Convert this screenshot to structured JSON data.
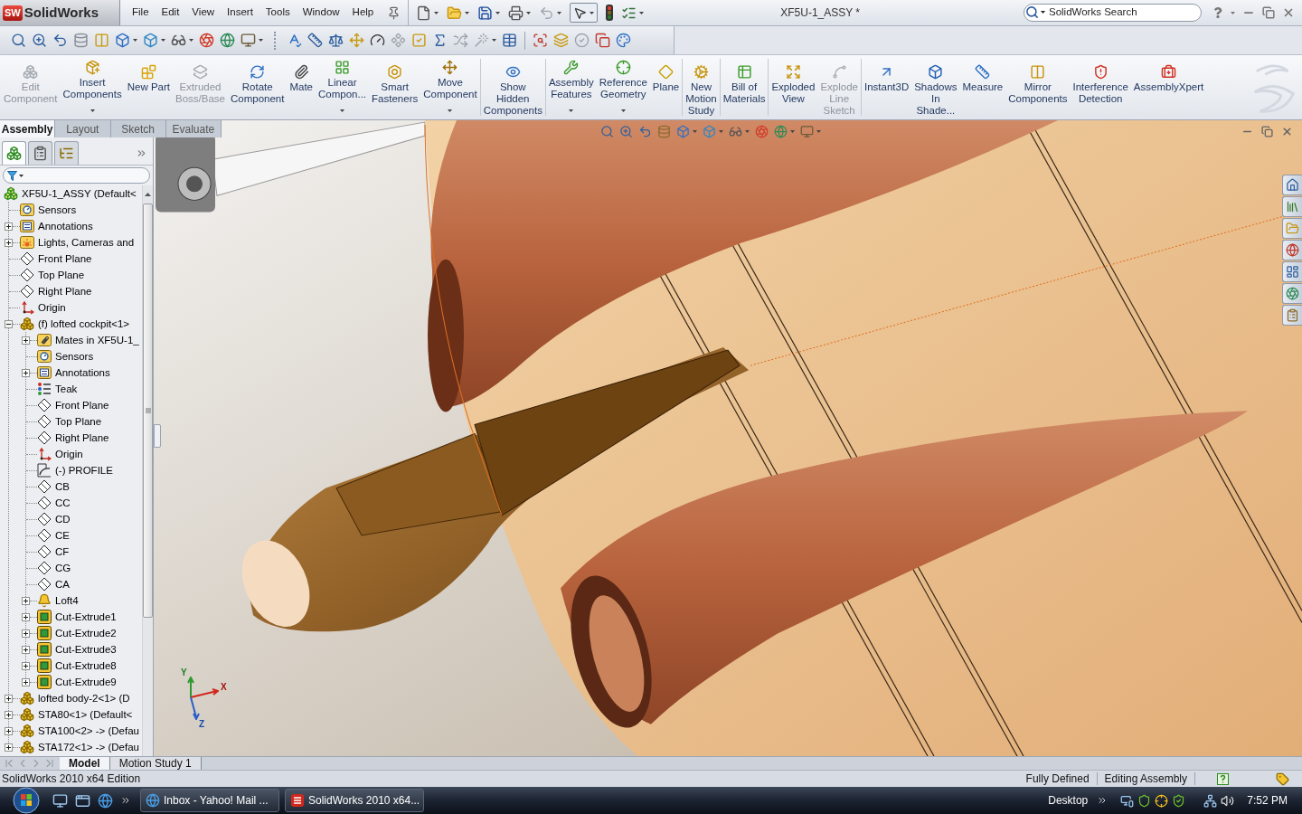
{
  "title_bar": {
    "logo_badge": "SW",
    "logo": "SolidWorks",
    "menus": [
      "File",
      "Edit",
      "View",
      "Insert",
      "Tools",
      "Window",
      "Help"
    ],
    "document_title": "XF5U-1_ASSY *",
    "search": {
      "placeholder": "SolidWorks Search"
    }
  },
  "command_groups": [
    [
      {
        "label": "Edit\nComponent",
        "disabled": true,
        "dropdown": false
      },
      {
        "label": "Insert\nComponents",
        "disabled": false,
        "dropdown": true
      },
      {
        "label": "New Part",
        "disabled": false,
        "dropdown": false
      },
      {
        "label": "Extruded\nBoss/Base",
        "disabled": true,
        "dropdown": false
      },
      {
        "label": "Rotate\nComponent",
        "disabled": false,
        "dropdown": false
      },
      {
        "label": "Mate",
        "disabled": false,
        "dropdown": false
      },
      {
        "label": "Linear\nCompon...",
        "disabled": false,
        "dropdown": true
      },
      {
        "label": "Smart\nFasteners",
        "disabled": false,
        "dropdown": false
      },
      {
        "label": "Move\nComponent",
        "disabled": false,
        "dropdown": true
      }
    ],
    [
      {
        "label": "Show\nHidden\nComponents",
        "disabled": false,
        "dropdown": false
      }
    ],
    [
      {
        "label": "Assembly\nFeatures",
        "disabled": false,
        "dropdown": true
      },
      {
        "label": "Reference\nGeometry",
        "disabled": false,
        "dropdown": true
      },
      {
        "label": "Plane",
        "disabled": false,
        "dropdown": false
      }
    ],
    [
      {
        "label": "New\nMotion\nStudy",
        "disabled": false,
        "dropdown": false
      }
    ],
    [
      {
        "label": "Bill of\nMaterials",
        "disabled": false,
        "dropdown": false
      }
    ],
    [
      {
        "label": "Exploded\nView",
        "disabled": false,
        "dropdown": false
      },
      {
        "label": "Explode\nLine\nSketch",
        "disabled": true,
        "dropdown": false
      }
    ],
    [
      {
        "label": "Instant3D",
        "disabled": false,
        "dropdown": false
      },
      {
        "label": "Shadows\nIn\nShade...",
        "disabled": false,
        "dropdown": false
      },
      {
        "label": "Measure",
        "disabled": false,
        "dropdown": false
      },
      {
        "label": "Mirror\nComponents",
        "disabled": false,
        "dropdown": false
      },
      {
        "label": "Interference\nDetection",
        "disabled": false,
        "dropdown": false
      },
      {
        "label": "AssemblyXpert",
        "disabled": false,
        "dropdown": false
      }
    ]
  ],
  "command_tabs": [
    {
      "label": "Assembly",
      "selected": true
    },
    {
      "label": "Layout",
      "selected": false
    },
    {
      "label": "Sketch",
      "selected": false
    },
    {
      "label": "Evaluate",
      "selected": false
    }
  ],
  "feature_tree": {
    "panel_tabs": [
      {
        "selected": true
      },
      {
        "selected": false
      },
      {
        "selected": false
      }
    ],
    "items": [
      {
        "label": "XF5U-1_ASSY (Default<",
        "kind": "assembly",
        "children": [
          {
            "label": "Sensors",
            "kind": "sensors"
          },
          {
            "label": "Annotations",
            "kind": "annotations",
            "expanded": false
          },
          {
            "label": "Lights, Cameras and",
            "kind": "lights",
            "expanded": false
          },
          {
            "label": "Front Plane",
            "kind": "plane"
          },
          {
            "label": "Top Plane",
            "kind": "plane"
          },
          {
            "label": "Right Plane",
            "kind": "plane"
          },
          {
            "label": "Origin",
            "kind": "origin"
          },
          {
            "label": "(f) lofted cockpit<1>",
            "kind": "part",
            "expanded": true,
            "children": [
              {
                "label": "Mates in XF5U-1_",
                "kind": "mates",
                "expanded": false
              },
              {
                "label": "Sensors",
                "kind": "sensors"
              },
              {
                "label": "Annotations",
                "kind": "annotations",
                "expanded": false
              },
              {
                "label": "Teak",
                "kind": "material"
              },
              {
                "label": "Front Plane",
                "kind": "plane"
              },
              {
                "label": "Top Plane",
                "kind": "plane"
              },
              {
                "label": "Right Plane",
                "kind": "plane"
              },
              {
                "label": "Origin",
                "kind": "origin"
              },
              {
                "label": "(-) PROFILE",
                "kind": "sketch"
              },
              {
                "label": "CB",
                "kind": "plane"
              },
              {
                "label": "CC",
                "kind": "plane"
              },
              {
                "label": "CD",
                "kind": "plane"
              },
              {
                "label": "CE",
                "kind": "plane"
              },
              {
                "label": "CF",
                "kind": "plane"
              },
              {
                "label": "CG",
                "kind": "plane"
              },
              {
                "label": "CA",
                "kind": "plane"
              },
              {
                "label": "Loft4",
                "kind": "loft",
                "expanded": false
              },
              {
                "label": "Cut-Extrude1",
                "kind": "cut",
                "expanded": false
              },
              {
                "label": "Cut-Extrude2",
                "kind": "cut",
                "expanded": false
              },
              {
                "label": "Cut-Extrude3",
                "kind": "cut",
                "expanded": false
              },
              {
                "label": "Cut-Extrude8",
                "kind": "cut",
                "expanded": false
              },
              {
                "label": "Cut-Extrude9",
                "kind": "cut",
                "expanded": false
              }
            ]
          },
          {
            "label": "lofted body-2<1> (D",
            "kind": "part",
            "expanded": false
          },
          {
            "label": "STA80<1> (Default<",
            "kind": "part",
            "expanded": false
          },
          {
            "label": "STA100<2> -> (Defau",
            "kind": "part",
            "expanded": false
          },
          {
            "label": "STA172<1> -> (Defau",
            "kind": "part",
            "expanded": false
          }
        ]
      }
    ]
  },
  "viewport": {
    "triad": {
      "y": "Y",
      "x": "X",
      "z": "Z"
    }
  },
  "bottom_tabs": [
    {
      "label": "Model",
      "selected": true
    },
    {
      "label": "Motion Study 1",
      "selected": false
    }
  ],
  "status_bar": {
    "edition": "SolidWorks 2010 x64 Edition",
    "state": "Fully Defined",
    "mode": "Editing Assembly"
  },
  "taskbar": {
    "tasks": [
      {
        "kind": "browser",
        "label": "Inbox - Yahoo! Mail ..."
      },
      {
        "kind": "solidworks",
        "label": "SolidWorks 2010 x64..."
      }
    ],
    "desktop": "Desktop",
    "clock": "7:52 PM"
  }
}
